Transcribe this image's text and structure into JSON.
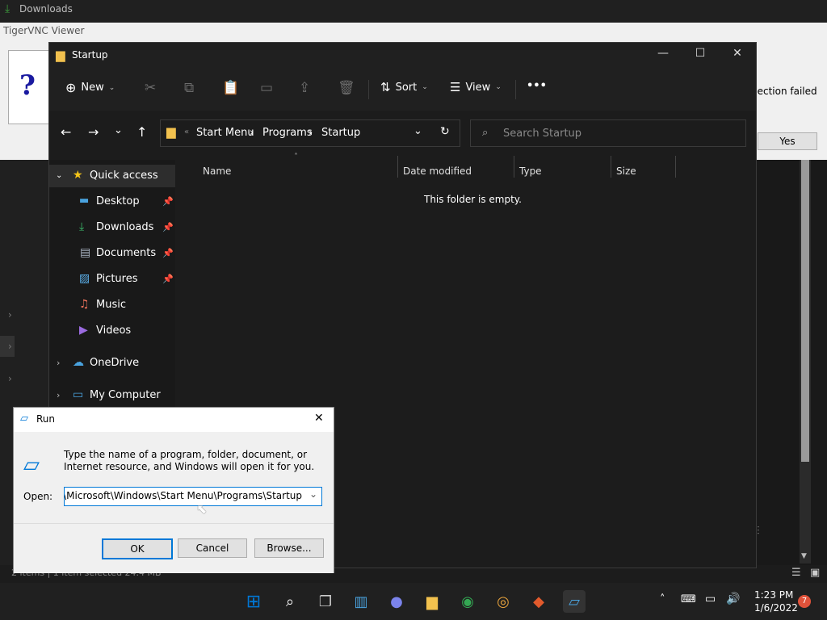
{
  "background": {
    "downloads_title": "Downloads",
    "status_text": "2 items   |   1 item selected  24.4 MB"
  },
  "vnc": {
    "title": "TigerVNC Viewer",
    "question_icon": "question-icon",
    "message": "nection failed",
    "yes_label": "Yes"
  },
  "explorer": {
    "title": "Startup",
    "toolbar": {
      "new_label": "New",
      "sort_label": "Sort",
      "view_label": "View",
      "more_label": "•••"
    },
    "breadcrumb": [
      "Start Menu",
      "Programs",
      "Startup"
    ],
    "search_placeholder": "Search Startup",
    "nav": {
      "quick_access": "Quick access",
      "items": [
        {
          "label": "Desktop",
          "pinned": true
        },
        {
          "label": "Downloads",
          "pinned": true
        },
        {
          "label": "Documents",
          "pinned": true
        },
        {
          "label": "Pictures",
          "pinned": true
        },
        {
          "label": "Music",
          "pinned": false
        },
        {
          "label": "Videos",
          "pinned": false
        }
      ],
      "onedrive": "OneDrive",
      "my_computer": "My Computer"
    },
    "columns": [
      "Name",
      "Date modified",
      "Type",
      "Size"
    ],
    "empty_message": "This folder is empty."
  },
  "run_dialog": {
    "title": "Run",
    "description": "Type the name of a program, folder, document, or Internet resource, and Windows will open it for you.",
    "open_label": "Open:",
    "open_value": "\\AppData\\Roaming\\Microsoft\\Windows\\Start Menu\\Programs\\Startup",
    "ok_label": "OK",
    "cancel_label": "Cancel",
    "browse_label": "Browse..."
  },
  "taskbar": {
    "time": "1:23 PM",
    "date": "1/6/2022",
    "notification_count": "7",
    "accent": "#0078d7"
  }
}
